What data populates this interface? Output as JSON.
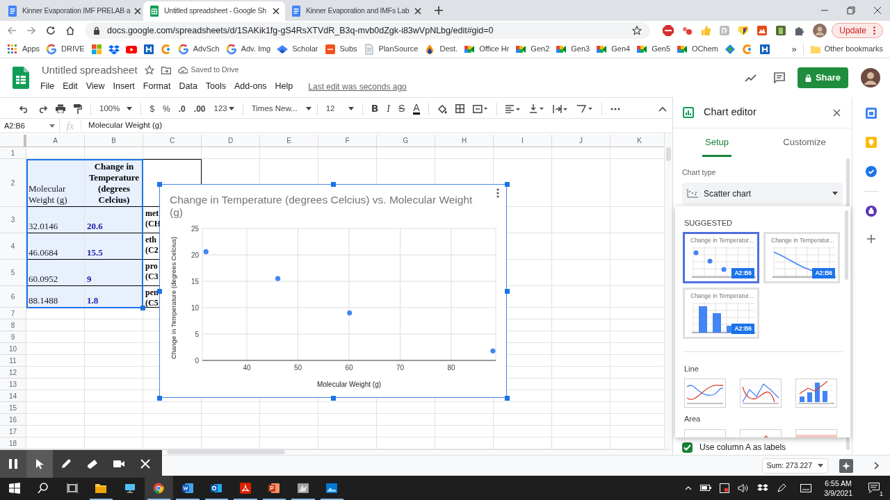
{
  "browser": {
    "tabs": [
      {
        "title": "Kinner Evaporation IMF PRELAB a",
        "kind": "docs",
        "selected": false
      },
      {
        "title": "Untitled spreadsheet - Google Sh",
        "kind": "sheets",
        "selected": true
      },
      {
        "title": "Kinner Evaporation and IMFs Lab",
        "kind": "docs",
        "selected": false
      }
    ],
    "url": "docs.google.com/spreadsheets/d/1SAKik1fg-gS4RsXTVdR_B3q-mvb0dZgk-i83wVpNLbg/edit#gid=0",
    "update_button": "Update",
    "bookmarks": [
      {
        "label": "Apps",
        "kind": "apps"
      },
      {
        "label": "DRIVE",
        "kind": "google"
      },
      {
        "kind": "windows"
      },
      {
        "kind": "dropbox"
      },
      {
        "kind": "youtube"
      },
      {
        "kind": "h"
      },
      {
        "kind": "c"
      },
      {
        "label": "AdvSch",
        "kind": "google"
      },
      {
        "label": "Adv. Img",
        "kind": "google"
      },
      {
        "label": "Scholar",
        "kind": "scholar"
      },
      {
        "label": "Subs",
        "kind": "sfe"
      },
      {
        "label": "PlanSource",
        "kind": "doc"
      },
      {
        "label": "Dest.",
        "kind": "dest"
      },
      {
        "label": "Office Hr",
        "kind": "meet"
      },
      {
        "label": "Gen2",
        "kind": "meet"
      },
      {
        "label": "Gen3",
        "kind": "meet"
      },
      {
        "label": "Gen4",
        "kind": "meet"
      },
      {
        "label": "Gen5",
        "kind": "meet"
      },
      {
        "label": "OChem",
        "kind": "meet"
      },
      {
        "kind": "diamond"
      },
      {
        "kind": "c"
      },
      {
        "kind": "h"
      }
    ],
    "more_bookmarks": "»",
    "other_bookmarks": "Other bookmarks"
  },
  "doc": {
    "title": "Untitled spreadsheet",
    "status": "Saved to Drive",
    "menu": [
      "File",
      "Edit",
      "View",
      "Insert",
      "Format",
      "Data",
      "Tools",
      "Add-ons",
      "Help"
    ],
    "last_edit": "Last edit was seconds ago",
    "share": "Share"
  },
  "toolbar": {
    "zoom": "100%",
    "currency": "$",
    "percent": "%",
    "decrease_decimals": ".0",
    "increase_decimals": ".00",
    "number_format": "123",
    "font": "Times New...",
    "font_size": "12",
    "bold": "B",
    "italic": "I",
    "strike": "S",
    "text_color": "A"
  },
  "formula_bar": {
    "name_box": "A2:B6",
    "fx": "fx",
    "formula": "Molecular Weight (g)"
  },
  "sheet": {
    "columns": [
      "A",
      "B",
      "C",
      "D",
      "E",
      "F",
      "G",
      "H",
      "I",
      "J",
      "K"
    ],
    "rows": [
      {
        "number": "1"
      },
      {
        "number": "2",
        "cells": [
          {
            "text": "Molecular Weight (g)",
            "kind": "text",
            "selected": true
          },
          {
            "text": "Change in Temperature (degrees Celcius)",
            "kind": "header",
            "selected": true
          }
        ]
      },
      {
        "number": "3",
        "cells": [
          {
            "text": "32.0146",
            "kind": "text",
            "selected": true
          },
          {
            "text": "20.6",
            "kind": "value",
            "selected": true
          },
          {
            "text": "met (CH",
            "kind": "name",
            "selected": false
          }
        ]
      },
      {
        "number": "4",
        "cells": [
          {
            "text": "46.0684",
            "kind": "text",
            "selected": true
          },
          {
            "text": "15.5",
            "kind": "value",
            "selected": true
          },
          {
            "text": "eth (C2",
            "kind": "name",
            "selected": false
          }
        ]
      },
      {
        "number": "5",
        "cells": [
          {
            "text": "60.0952",
            "kind": "text",
            "selected": true
          },
          {
            "text": "9",
            "kind": "value",
            "selected": true
          },
          {
            "text": "pro (C3",
            "kind": "name",
            "selected": false
          }
        ]
      },
      {
        "number": "6",
        "cells": [
          {
            "text": "88.1488",
            "kind": "text",
            "selected": true
          },
          {
            "text": "1.8",
            "kind": "value",
            "selected": true
          },
          {
            "text": "pen (C5",
            "kind": "name",
            "selected": false
          }
        ]
      },
      {
        "number": "7"
      },
      {
        "number": "8"
      },
      {
        "number": "9"
      },
      {
        "number": "10"
      },
      {
        "number": "11"
      },
      {
        "number": "12"
      },
      {
        "number": "13"
      },
      {
        "number": "14"
      },
      {
        "number": "15"
      },
      {
        "number": "16"
      },
      {
        "number": "17"
      },
      {
        "number": "18"
      }
    ],
    "chart": {
      "chart_data": {
        "type": "scatter",
        "title": "Change in Temperature (degrees Celcius) vs. Molecular Weight (g)",
        "xlabel": "Molecular Weight (g)",
        "ylabel": "Change in Temperature (degrees Celcius)",
        "x": [
          32.0146,
          46.0684,
          60.0952,
          88.1488
        ],
        "series": [
          {
            "color": "#4285f4",
            "values": [
              20.6,
              15.5,
              9,
              1.8
            ]
          }
        ],
        "xlim": [
          31.3,
          88.7
        ],
        "ylim": [
          0,
          25
        ],
        "grid": true,
        "xticks": [
          40,
          50,
          60,
          70,
          80
        ],
        "yticks": [
          0,
          5,
          10,
          15,
          20,
          25
        ]
      }
    }
  },
  "chart_editor": {
    "title": "Chart editor",
    "tabs": [
      {
        "label": "Setup",
        "selected": true
      },
      {
        "label": "Customize",
        "selected": false
      }
    ],
    "chart_type_label": "Chart type",
    "chart_type": "Scatter chart",
    "picker": {
      "suggested_heading": "SUGGESTED",
      "suggestions": [
        {
          "kind": "scatter",
          "title": "Change in Temperatur...",
          "range": "A2:B6",
          "selected": true
        },
        {
          "kind": "line",
          "title": "Change in Temperatur...",
          "range": "A2:B6",
          "selected": false
        },
        {
          "kind": "column",
          "title": "Change in Temperatur...",
          "range": "A2:B6",
          "selected": false
        }
      ],
      "sections": [
        {
          "heading": "Line",
          "thumbnails": [
            {
              "kind": "line"
            },
            {
              "kind": "smooth"
            },
            {
              "kind": "combo"
            }
          ]
        },
        {
          "heading": "Area",
          "thumbnails": [
            {
              "kind": "area"
            },
            {
              "kind": "stepped"
            },
            {
              "kind": "filled"
            }
          ]
        }
      ]
    },
    "labels_checkbox": {
      "label": "Use column A as labels",
      "checked": true
    }
  },
  "status_bar": {
    "sum": "Sum: 273.227"
  },
  "taskbar": {
    "time": "6:55 AM",
    "date": "3/9/2021",
    "notifications": "1"
  }
}
